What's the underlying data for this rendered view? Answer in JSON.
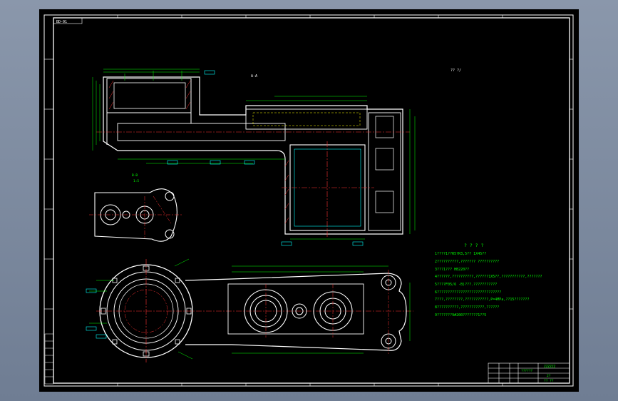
{
  "drawing": {
    "zone_label": "BD-01",
    "section_aa_label": "A-A",
    "section_bb_label": "B-B",
    "section_bb_scale": "1:5",
    "roughness_note": "??  ?/",
    "notes_title": "? ? ? ?",
    "notes": [
      "1????1??R5?R3,5?? 1X45??",
      "2??????????,??????? ??????????",
      "3???1??? HB220??",
      "4??????,??????????,??????1X5??,???????????,???????",
      "5????F05/6 -B)???.???????????",
      "6??????????????????????????????",
      "7???,????????,???????????,P=4MPa,??15???????",
      "8??????????,???????????,??????",
      "9???????9#200???????1??5"
    ],
    "title_block": {
      "part_name": "??????",
      "code": "ZZZZZZ",
      "material": "2?",
      "sheet": "?? ??"
    },
    "colors": {
      "sheet": "#000000",
      "outline": "#ffffff",
      "dimension": "#00ff00",
      "centerline": "#ff3333",
      "hidden": "#ffff00",
      "label_box": "#00ffff",
      "text": "#00ff00"
    }
  }
}
